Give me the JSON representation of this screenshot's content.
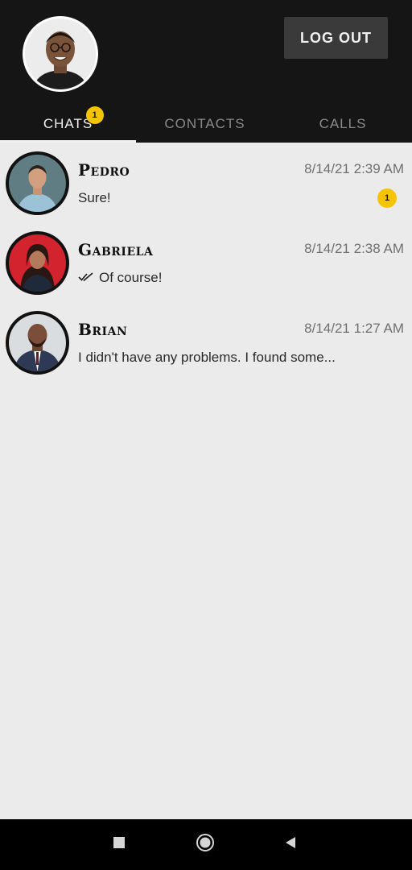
{
  "header": {
    "logout_label": "LOG OUT"
  },
  "tabs": [
    {
      "label": "CHATS",
      "active": true,
      "badge": "1"
    },
    {
      "label": "CONTACTS",
      "active": false
    },
    {
      "label": "CALLS",
      "active": false
    }
  ],
  "chats": [
    {
      "name": "Pedro",
      "time": "8/14/21 2:39 AM",
      "preview": "Sure!",
      "unread": "1",
      "read_receipt": false
    },
    {
      "name": "Gabriela",
      "time": "8/14/21 2:38 AM",
      "preview": "Of course!",
      "read_receipt": true
    },
    {
      "name": "Brian",
      "time": "8/14/21 1:27 AM",
      "preview": "I didn't have any problems. I found some...",
      "read_receipt": false
    }
  ],
  "navigation": {
    "buttons": [
      "recent-apps",
      "home",
      "back"
    ]
  },
  "colors": {
    "header_bg": "#151515",
    "list_bg": "#ebebeb",
    "badge": "#f5c400",
    "button_bg": "#3a3a3a"
  }
}
